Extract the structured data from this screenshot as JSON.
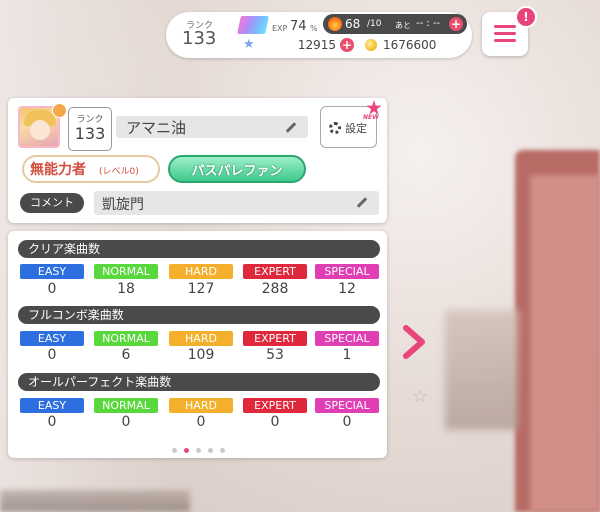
{
  "status": {
    "rank_label": "ランク",
    "rank_value": "133",
    "exp_label": "EXP",
    "exp_value": "74",
    "exp_unit": "%",
    "live_value": "68",
    "live_max": "/10",
    "live_ato": "あと",
    "live_timer": "-- : --",
    "star_value": "12915",
    "coin_value": "1676600",
    "plus": "+"
  },
  "menu": {
    "badge": "!"
  },
  "profile": {
    "rank_label": "ランク",
    "rank_value": "133",
    "name": "アマニ油",
    "settings_label": "設定",
    "new_label": "NEW",
    "title_main": "無能力者",
    "title_sub": "(レベル0)",
    "band": "パスパレファン",
    "comment_label": "コメント",
    "comment": "凱旋門"
  },
  "stats": {
    "difficulties": [
      "EASY",
      "NORMAL",
      "HARD",
      "EXPERT",
      "SPECIAL"
    ],
    "sections": [
      {
        "title": "クリア楽曲数",
        "values": [
          "0",
          "18",
          "127",
          "288",
          "12"
        ]
      },
      {
        "title": "フルコンボ楽曲数",
        "values": [
          "0",
          "6",
          "109",
          "53",
          "1"
        ]
      },
      {
        "title": "オールパーフェクト楽曲数",
        "values": [
          "0",
          "0",
          "0",
          "0",
          "0"
        ]
      }
    ],
    "page_count": 5,
    "active_page": 2
  },
  "colors": {
    "accent": "#e8467a",
    "easy": "#2e6fe0",
    "normal": "#58d83c",
    "hard": "#f4b02c",
    "expert": "#e0283c",
    "special": "#e03fb4"
  }
}
